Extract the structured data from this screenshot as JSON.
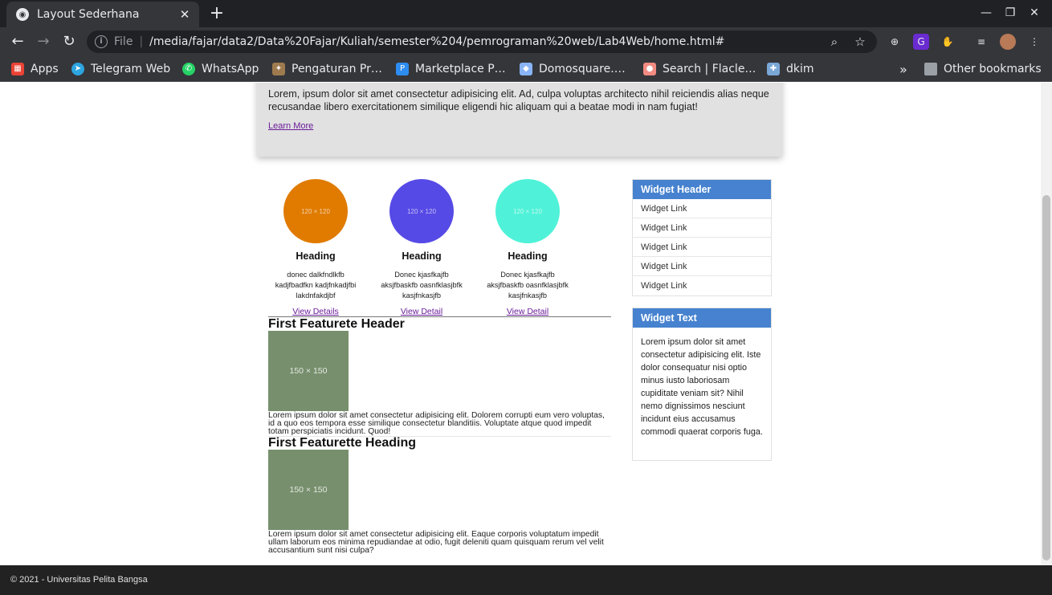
{
  "browser": {
    "tab_title": "Layout Sederhana",
    "tab_close": "✕",
    "new_tab": "+",
    "scheme": "File",
    "url": "/media/fajar/data2/Data%20Fajar/Kuliah/semester%204/pemrograman%20web/Lab4Web/home.html#",
    "bookmarks": [
      {
        "label": "Apps",
        "color": "#ea4335"
      },
      {
        "label": "Telegram Web",
        "color": "#2ca5e0"
      },
      {
        "label": "WhatsApp",
        "color": "#25d366"
      },
      {
        "label": "Pengaturan Pr…",
        "color": "#9e7b4f"
      },
      {
        "label": "Marketplace P…",
        "color": "#2d8cf0"
      },
      {
        "label": "Domosquare.…",
        "color": "#8ab4f8"
      },
      {
        "label": "Search | Flacle…",
        "color": "#f28b82"
      },
      {
        "label": "dkim",
        "color": "#7aa7d6"
      }
    ],
    "more_bookmarks": "»",
    "other_bookmarks": "Other bookmarks"
  },
  "hero": {
    "text": "Lorem, ipsum dolor sit amet consectetur adipisicing elit. Ad, culpa voluptas architecto nihil reiciendis alias neque recusandae libero exercitationem similique eligendi hic aliquam qui a beatae modi in nam fugiat!",
    "link": "Learn More"
  },
  "features": [
    {
      "color": "#e07b00",
      "placeholder": "120 × 120",
      "heading": "Heading",
      "text": "donec dalkfndlkfb kadjfbadfkn kadjfnkadjfbi lakdnfakdjbf",
      "link": "View Details"
    },
    {
      "color": "#564ae6",
      "placeholder": "120 × 120",
      "heading": "Heading",
      "text": "Donec kjasfkajfb aksjfbaskfb oasnfklasjbfk kasjfnkasjfb",
      "link": "View Detail"
    },
    {
      "color": "#4ff2d8",
      "placeholder": "120 × 120",
      "heading": "Heading",
      "text": "Donec kjasfkajfb aksjfbaskfb oasnfklasjbfk kasjfnkasjfb",
      "link": "View Detail"
    }
  ],
  "featurettes": [
    {
      "title": "First Featurete Header",
      "placeholder": "150 × 150",
      "text": "Lorem ipsum dolor sit amet consectetur adipisicing elit. Dolorem corrupti eum vero voluptas, id a quo eos tempora esse similique consectetur blanditiis. Voluptate atque quod impedit totam perspiciatis incidunt. Quod!"
    },
    {
      "title": "First Featurette Heading",
      "placeholder": "150 × 150",
      "text": "Lorem ipsum dolor sit amet consectetur adipisicing elit. Eaque corporis voluptatum impedit ullam laborum eos minima repudiandae at odio, fugit deleniti quam quisquam rerum vel velit accusantium sunt nisi culpa?"
    }
  ],
  "widget_links": {
    "header": "Widget Header",
    "links": [
      "Widget Link",
      "Widget Link",
      "Widget Link",
      "Widget Link",
      "Widget Link"
    ]
  },
  "widget_text": {
    "header": "Widget Text",
    "body": "Lorem ipsum dolor sit amet consectetur adipisicing elit. Iste dolor consequatur nisi optio minus iusto laboriosam cupiditate veniam sit? Nihil nemo dignissimos nesciunt incidunt eius accusamus commodi quaerat corporis fuga."
  },
  "footer": "© 2021 - Universitas Pelita Bangsa"
}
